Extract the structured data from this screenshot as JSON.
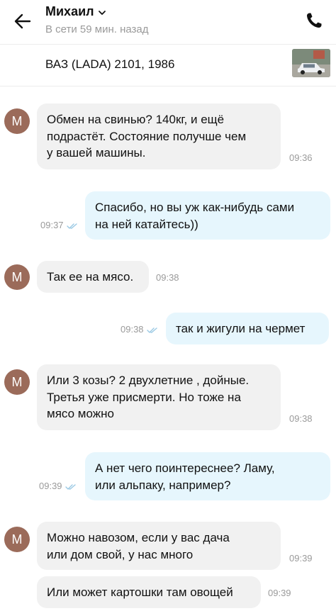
{
  "header": {
    "contact_name": "Михаил",
    "status": "В сети 59 мин. назад"
  },
  "listing": {
    "title": "ВАЗ (LADA) 2101, 1986"
  },
  "messages": [
    {
      "from": "in",
      "avatar": "М",
      "text": "Обмен на свинью? 140кг, и ещё\nподрастёт. Состояние получше чем\nу вашей машины.",
      "time": "09:36"
    },
    {
      "from": "out",
      "text": "Спасибо, но вы уж как-нибудь сами\nна ней катайтесь))",
      "time": "09:37"
    },
    {
      "from": "in",
      "avatar": "М",
      "text": "Так ее на мясо.",
      "time": "09:38"
    },
    {
      "from": "out",
      "text": "так и жигули на чермет",
      "time": "09:38"
    },
    {
      "from": "in",
      "avatar": "М",
      "text": "Или 3 козы? 2 двухлетние , дойные.\nТретья уже присмерти. Но тоже на\nмясо можно",
      "time": "09:38"
    },
    {
      "from": "out",
      "text": "А нет чего поинтереснее? Ламу,\nили альпаку, например?",
      "time": "09:39"
    },
    {
      "from": "in",
      "avatar": "М",
      "text": "Можно навозом, если у вас дача\nили дом свой, у нас много",
      "time": "09:39"
    },
    {
      "from": "in",
      "text": "Или может картошки там овощей",
      "time": "09:39"
    }
  ]
}
